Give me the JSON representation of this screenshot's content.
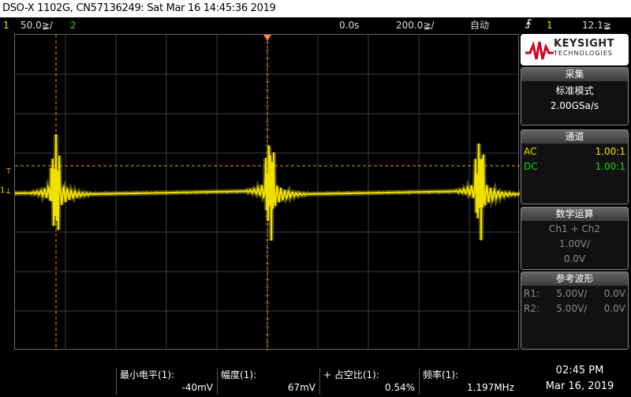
{
  "title_bar": {
    "text": "DSO-X 1102G, CN57136249: Sat Mar 16 14:45:36 2019"
  },
  "status": {
    "ch1_num": "1",
    "ch1_scale": "50.0≩/",
    "ch2_num": "2",
    "time_delay": "0.0s",
    "time_scale": "200.0≩/",
    "trigger_mode": "自动",
    "trigger_channel": "1",
    "trigger_level": "12.1≩"
  },
  "brand": {
    "name": "KEYSIGHT",
    "sub": "TECHNOLOGIES"
  },
  "acquire": {
    "title": "采集",
    "mode": "标准模式",
    "rate": "2.00GSa/s"
  },
  "channels": {
    "title": "通道",
    "rows": [
      {
        "label": "AC",
        "value": "1.00:1"
      },
      {
        "label": "DC",
        "value": "1.00:1"
      }
    ]
  },
  "math": {
    "title": "数学运算",
    "expr": "Ch1 + Ch2",
    "scale": "1.00V/",
    "offset": "0.0V"
  },
  "reference": {
    "title": "参考波形",
    "rows": [
      {
        "label": "R1:",
        "scale": "5.00V/",
        "offset": "0.0V"
      },
      {
        "label": "R2:",
        "scale": "5.00V/",
        "offset": "0.0V"
      }
    ]
  },
  "measurements": [
    {
      "label": "最小电平(1):",
      "value": "-40mV"
    },
    {
      "label": "幅度(1):",
      "value": "67mV"
    },
    {
      "label": "+ 占空比(1):",
      "value": "0.54%"
    },
    {
      "label": "频率(1):",
      "value": "1.197MHz"
    }
  ],
  "clock": {
    "time": "02:45 PM",
    "date": "Mar 16, 2019"
  },
  "markers": {
    "trigger_label": "T",
    "ch1_ground": "1"
  },
  "colors": {
    "ch1": "#f2e100",
    "ch2": "#1fd21f",
    "cursor": "#ff8a1c"
  }
}
